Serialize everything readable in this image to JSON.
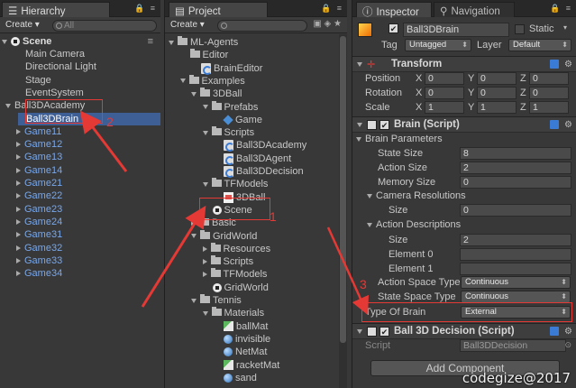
{
  "hierarchy": {
    "tab": "Hierarchy",
    "create": "Create",
    "search_placeholder": "All",
    "scene": "Scene",
    "items": [
      "Main Camera",
      "Directional Light",
      "Stage",
      "EventSystem",
      "Ball3DAcademy",
      "Ball3DBrain",
      "Game11",
      "Game12",
      "Game13",
      "Game14",
      "Game21",
      "Game22",
      "Game23",
      "Game24",
      "Game31",
      "Game32",
      "Game33",
      "Game34"
    ]
  },
  "project": {
    "tab": "Project",
    "create": "Create",
    "tree": [
      "ML-Agents",
      "Editor",
      "BrainEditor",
      "Examples",
      "3DBall",
      "Prefabs",
      "Game",
      "Scripts",
      "Ball3DAcademy",
      "Ball3DAgent",
      "Ball3DDecision",
      "TFModels",
      "3DBall",
      "Scene",
      "Basic",
      "GridWorld",
      "Resources",
      "Scripts",
      "TFModels",
      "GridWorld",
      "Tennis",
      "Materials",
      "ballMat",
      "invisible",
      "NetMat",
      "racketMat",
      "sand"
    ]
  },
  "inspector": {
    "tab": "Inspector",
    "tab2": "Navigation",
    "object_name": "Ball3DBrain",
    "static_label": "Static",
    "tag_label": "Tag",
    "tag_value": "Untagged",
    "layer_label": "Layer",
    "layer_value": "Default",
    "transform": {
      "title": "Transform",
      "position": "Position",
      "rotation": "Rotation",
      "scale": "Scale",
      "x": "X",
      "y": "Y",
      "z": "Z",
      "pos": [
        "0",
        "0",
        "0"
      ],
      "rot": [
        "0",
        "0",
        "0"
      ],
      "scl": [
        "1",
        "1",
        "1"
      ]
    },
    "brain": {
      "title": "Brain (Script)",
      "params": "Brain Parameters",
      "state_size_label": "State Size",
      "state_size": "8",
      "action_size_label": "Action Size",
      "action_size": "2",
      "memory_size_label": "Memory Size",
      "memory_size": "0",
      "cam_res": "Camera Resolutions",
      "size_label": "Size",
      "cam_size": "0",
      "action_desc": "Action Descriptions",
      "ad_size": "2",
      "el0": "Element 0",
      "el1": "Element 1",
      "action_space_label": "Action Space Type",
      "action_space": "Continuous",
      "state_space_label": "State Space Type",
      "state_space": "Continuous",
      "type_of_brain_label": "Type Of Brain",
      "type_of_brain": "External"
    },
    "decision": {
      "title": "Ball 3D Decision (Script)",
      "script_label": "Script",
      "script_value": "Ball3DDecision"
    },
    "add_component": "Add Component"
  },
  "annotations": {
    "one": "1",
    "two": "2",
    "three": "3"
  },
  "watermark": "codegize@2017",
  "colors": {
    "accent": "#e53935",
    "selection": "#3e5f96",
    "link": "#7aa7e8"
  }
}
